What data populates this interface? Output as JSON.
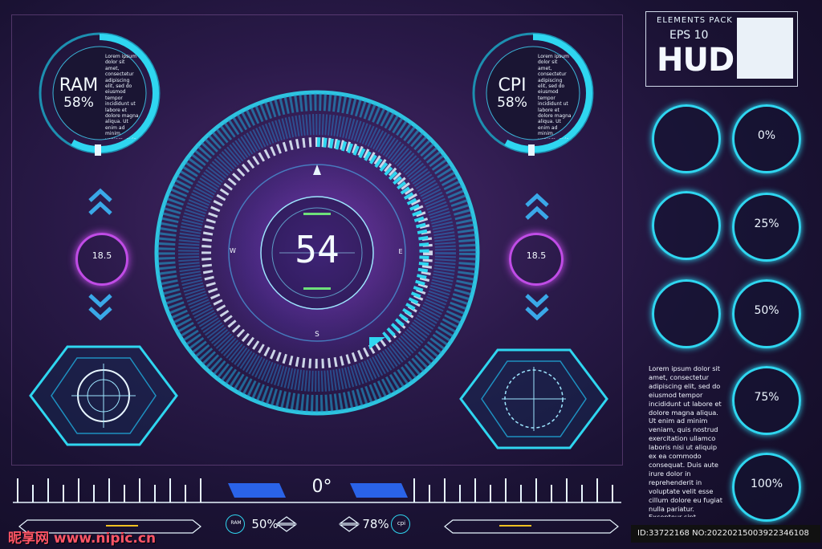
{
  "panels": {
    "left": {
      "label": "RAM",
      "value": "58%",
      "text": "Lorem ipsum dolor sit amet, consectetur adipiscing elit, sed do eiusmod tempor incididunt ut labore et dolore magna aliqua. Ut enim ad minim veniam, quis nostrud exercitation ullamco laboris"
    },
    "right": {
      "label": "CPI",
      "value": "58%",
      "text": "Lorem ipsum dolor sit amet, consectetur adipiscing elit, sed do eiusmod tempor incididunt ut labore et dolore magna aliqua. Ut enim ad minim veniam, quis nostrud exercitation ullamco laboris"
    }
  },
  "side_value_left": "18.5",
  "side_value_right": "18.5",
  "main_gauge": {
    "value": "54",
    "compass": {
      "n": "",
      "w": "W",
      "e": "E",
      "s": "S"
    }
  },
  "bottom_bar": {
    "degree": "0°",
    "left_pct": "50%",
    "left_tag": "RAM",
    "right_pct": "78%",
    "right_tag": "cpi"
  },
  "brand": {
    "line1": "ELEMENTS PACK",
    "line2": "EPS 10",
    "title": "HUD"
  },
  "dials": [
    {
      "label": ""
    },
    {
      "label": "0%"
    },
    {
      "label": ""
    },
    {
      "label": "25%"
    },
    {
      "label": ""
    },
    {
      "label": "50%"
    },
    {
      "label": "75%"
    },
    {
      "label": "100%"
    }
  ],
  "right_text": "Lorem ipsum dolor sit amet, consectetur adipiscing elit, sed do eiusmod tempor incididunt ut labore et dolore magna aliqua. Ut enim ad minim veniam, quis nostrud exercitation ullamco laboris nisi ut aliquip ex ea commodo consequat. Duis aute irure dolor in reprehenderit in voluptate velit esse cillum dolore eu fugiat nulla pariatur. Excepteur sint occaecat cupidatat non proident, sunt in culpa qui officia deserunt mollit anim id est laborum.",
  "watermark": "昵享网 www.nipic.cn",
  "image_id": "ID:33722168 NO:20220215003922346108",
  "colors": {
    "accent": "#2fd6f0",
    "glow": "#7b3bd8",
    "magenta": "#c04ce6"
  }
}
